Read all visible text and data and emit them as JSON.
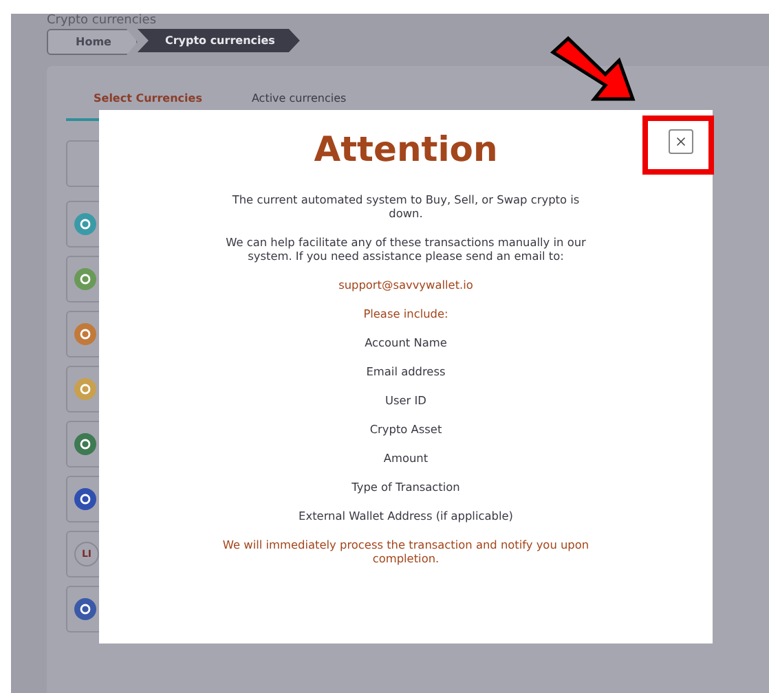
{
  "page": {
    "title": "Crypto currencies"
  },
  "breadcrumbs": [
    {
      "label": "Home",
      "selected": false
    },
    {
      "label": "Crypto currencies",
      "selected": true
    }
  ],
  "tabs": [
    {
      "label": "Select Currencies",
      "selected": true
    },
    {
      "label": "Active currencies",
      "selected": false
    }
  ],
  "coins": [
    {
      "color": "#3b9aa8"
    },
    {
      "color": "#6a9a58"
    },
    {
      "color": "#c27a3a"
    },
    {
      "color": "#c9a04e"
    },
    {
      "color": "#3e7a52"
    },
    {
      "color": "#3050b0"
    },
    {
      "label": "LI"
    },
    {
      "color": "#3a5aa8"
    }
  ],
  "dialog": {
    "title": "Attention",
    "lines": [
      {
        "kind": "text",
        "text": "The current automated system to Buy, Sell, or Swap crypto is down."
      },
      {
        "kind": "text",
        "text": "We can help facilitate any of these transactions manually in our system. If you need assistance please send an email to:"
      },
      {
        "kind": "link",
        "text": "support@savvywallet.io"
      },
      {
        "kind": "accent",
        "text": "Please include:"
      },
      {
        "kind": "text",
        "text": "Account Name"
      },
      {
        "kind": "text",
        "text": "Email address"
      },
      {
        "kind": "text",
        "text": "User ID"
      },
      {
        "kind": "text",
        "text": "Crypto Asset"
      },
      {
        "kind": "text",
        "text": "Amount"
      },
      {
        "kind": "text",
        "text": "Type of Transaction"
      },
      {
        "kind": "text",
        "text": "External Wallet Address (if applicable)"
      },
      {
        "kind": "accent",
        "text": "We will immediately process the transaction and notify you upon completion."
      }
    ]
  }
}
